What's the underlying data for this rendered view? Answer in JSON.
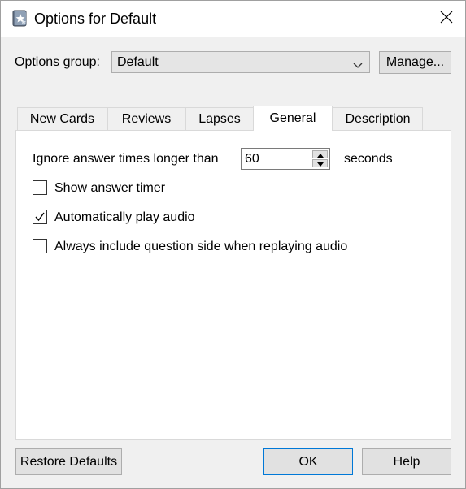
{
  "window": {
    "title": "Options for Default",
    "icons": {
      "app": "anki-star-icon",
      "close": "close-icon"
    }
  },
  "options_group": {
    "label": "Options group:",
    "selected": "Default",
    "manage_label": "Manage..."
  },
  "tabs": [
    {
      "label": "New Cards",
      "active": false
    },
    {
      "label": "Reviews",
      "active": false
    },
    {
      "label": "Lapses",
      "active": false
    },
    {
      "label": "General",
      "active": true
    },
    {
      "label": "Description",
      "active": false
    }
  ],
  "general": {
    "ignore_label": "Ignore answer times longer than",
    "ignore_value": "60",
    "ignore_unit": "seconds",
    "show_timer": {
      "label": "Show answer timer",
      "checked": false
    },
    "autoplay": {
      "label": "Automatically play audio",
      "checked": true
    },
    "include_question": {
      "label": "Always include question side when replaying audio",
      "checked": false
    }
  },
  "footer": {
    "restore_label": "Restore Defaults",
    "ok_label": "OK",
    "help_label": "Help"
  },
  "colors": {
    "accent": "#0078d7",
    "window_bg": "#f0f0f0",
    "panel_bg": "#ffffff"
  }
}
